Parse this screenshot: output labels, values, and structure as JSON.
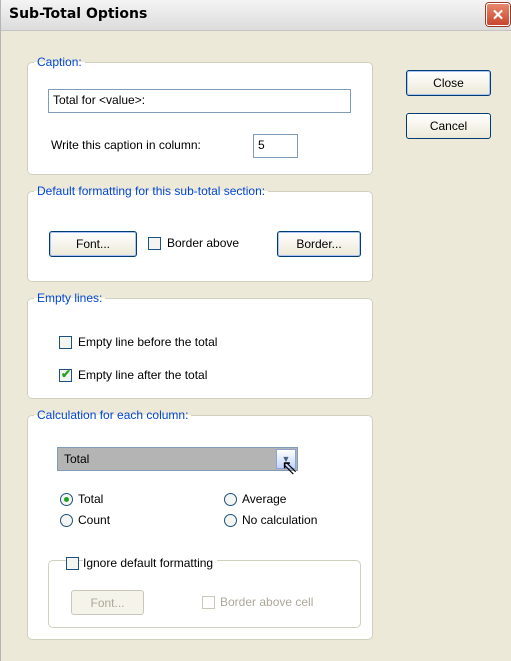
{
  "window": {
    "title": "Sub-Total Options"
  },
  "buttons": {
    "close": "Close",
    "cancel": "Cancel"
  },
  "caption_group": {
    "legend": "Caption:",
    "caption_value": "Total for <value>:",
    "column_label": "Write this caption in column:",
    "column_value": "5"
  },
  "formatting_group": {
    "legend": "Default formatting for this sub-total section:",
    "font_button": "Font...",
    "border_above_label": "Border above",
    "border_above_checked": false,
    "border_button": "Border..."
  },
  "empty_lines_group": {
    "legend": "Empty lines:",
    "before_label": "Empty line before the total",
    "before_checked": false,
    "after_label": "Empty line after the total",
    "after_checked": true
  },
  "calculation_group": {
    "legend": "Calculation for each column:",
    "selected_column": "Total",
    "radio_total": "Total",
    "radio_average": "Average",
    "radio_count": "Count",
    "radio_no_calc": "No calculation",
    "selected_option": "Total",
    "ignore_label": "Ignore default formatting",
    "ignore_checked": false,
    "inner_font_button": "Font...",
    "border_above_cell_label": "Border above cell"
  },
  "icons": {
    "close": "close-icon",
    "dropdown": "chevron-down-icon",
    "cursor": "mouse-cursor-icon"
  },
  "colors": {
    "legend": "#0046d5",
    "check": "#21a121",
    "close_button": "#c8462c"
  }
}
